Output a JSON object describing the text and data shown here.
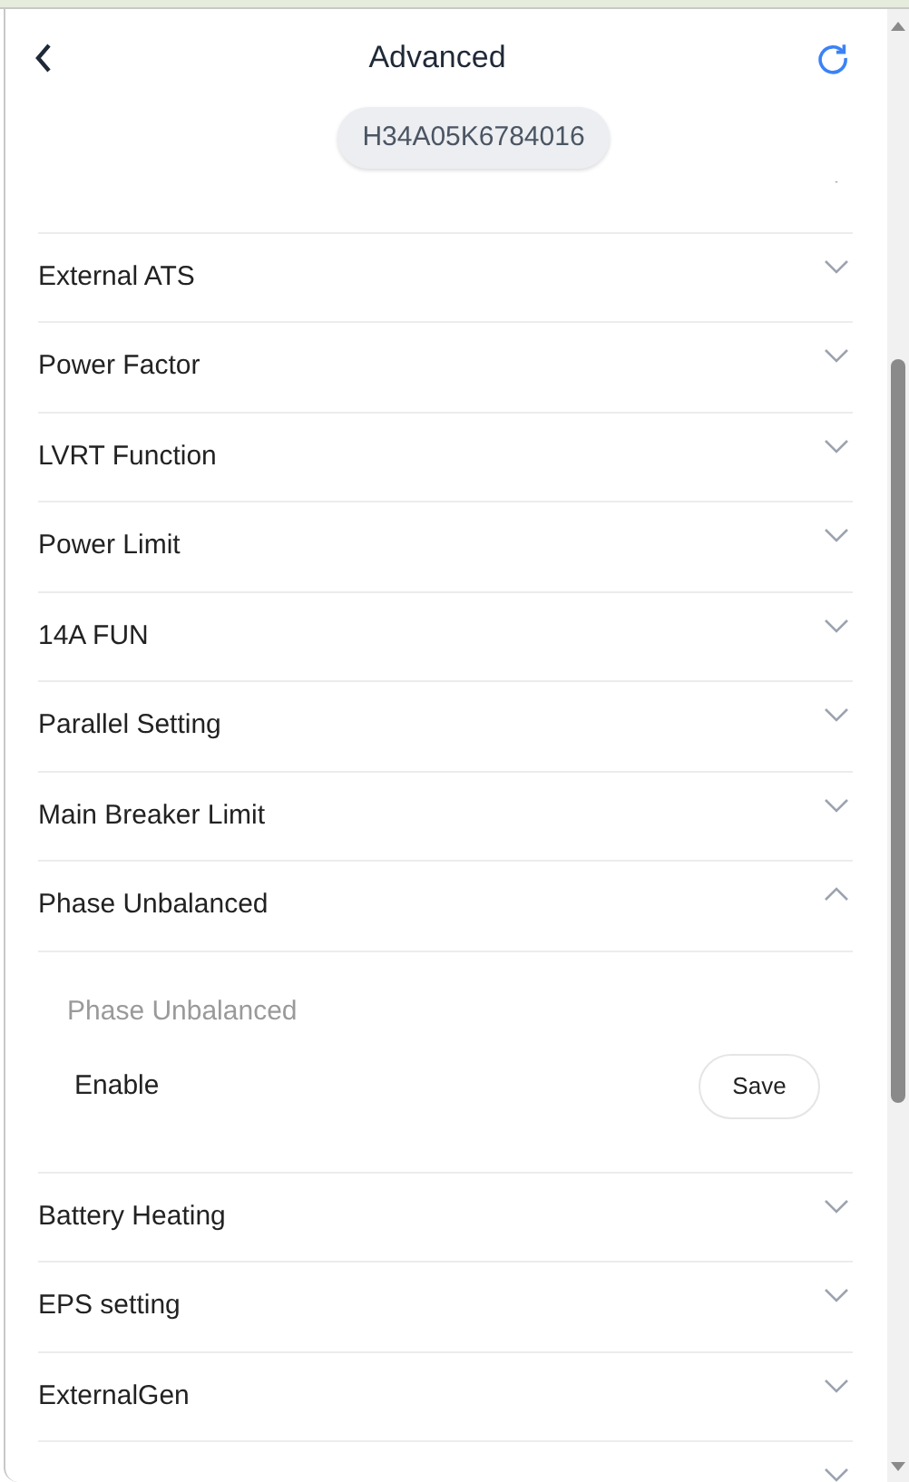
{
  "header": {
    "title": "Advanced"
  },
  "device": {
    "serial": "H34A05K6784016"
  },
  "sections": [
    {
      "expanded": false
    },
    {
      "title": "External ATS",
      "expanded": false
    },
    {
      "title": "Power Factor",
      "expanded": false
    },
    {
      "title": "LVRT Function",
      "expanded": false
    },
    {
      "title": "Power Limit",
      "expanded": false
    },
    {
      "title": "14A FUN",
      "expanded": false
    },
    {
      "title": "Parallel Setting",
      "expanded": false
    },
    {
      "title": "Main Breaker Limit",
      "expanded": false
    },
    {
      "title": "Phase Unbalanced",
      "expanded": true,
      "content": {
        "subtitle": "Phase Unbalanced",
        "setting": {
          "label": "Enable",
          "button": "Save"
        }
      }
    },
    {
      "title": "Battery Heating",
      "expanded": false
    },
    {
      "title": "EPS setting",
      "expanded": false
    },
    {
      "title": "ExternalGen",
      "expanded": false
    },
    {
      "expanded": false
    }
  ]
}
